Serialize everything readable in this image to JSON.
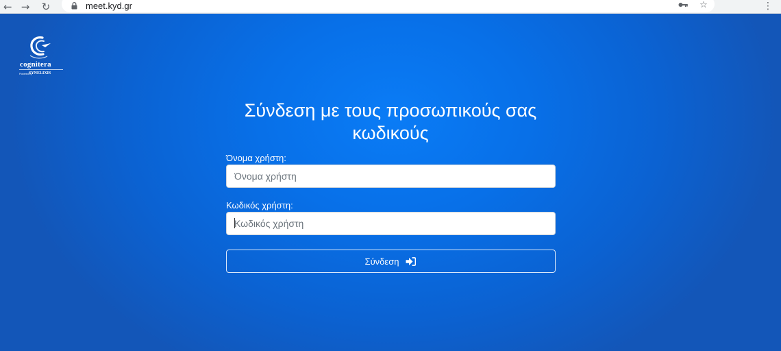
{
  "browser": {
    "url": "meet.kyd.gr",
    "icons": {
      "back": "arrow-left-icon",
      "forward": "arrow-right-icon",
      "reload": "reload-icon",
      "secure": "lock-icon",
      "password": "key-icon",
      "bookmark": "star-icon",
      "menu": "kebab-menu-icon"
    }
  },
  "logo": {
    "name": "cognitera",
    "powered_by": "Powered by",
    "brand": "SYNELIXIS"
  },
  "login": {
    "title": "Σύνδεση με τους προσωπικούς σας κωδικούς",
    "username_label": "Όνομα χρήστη:",
    "username_placeholder": "Όνομα χρήστη",
    "username_value": "",
    "password_label": "Κωδικός χρήστη:",
    "password_placeholder": "Κωδικός χρήστη",
    "password_value": "",
    "submit_label": "Σύνδεση",
    "submit_icon": "sign-in-icon"
  },
  "colors": {
    "page_background": "#0a74ee",
    "text": "#ffffff",
    "input_background": "#ffffff"
  }
}
